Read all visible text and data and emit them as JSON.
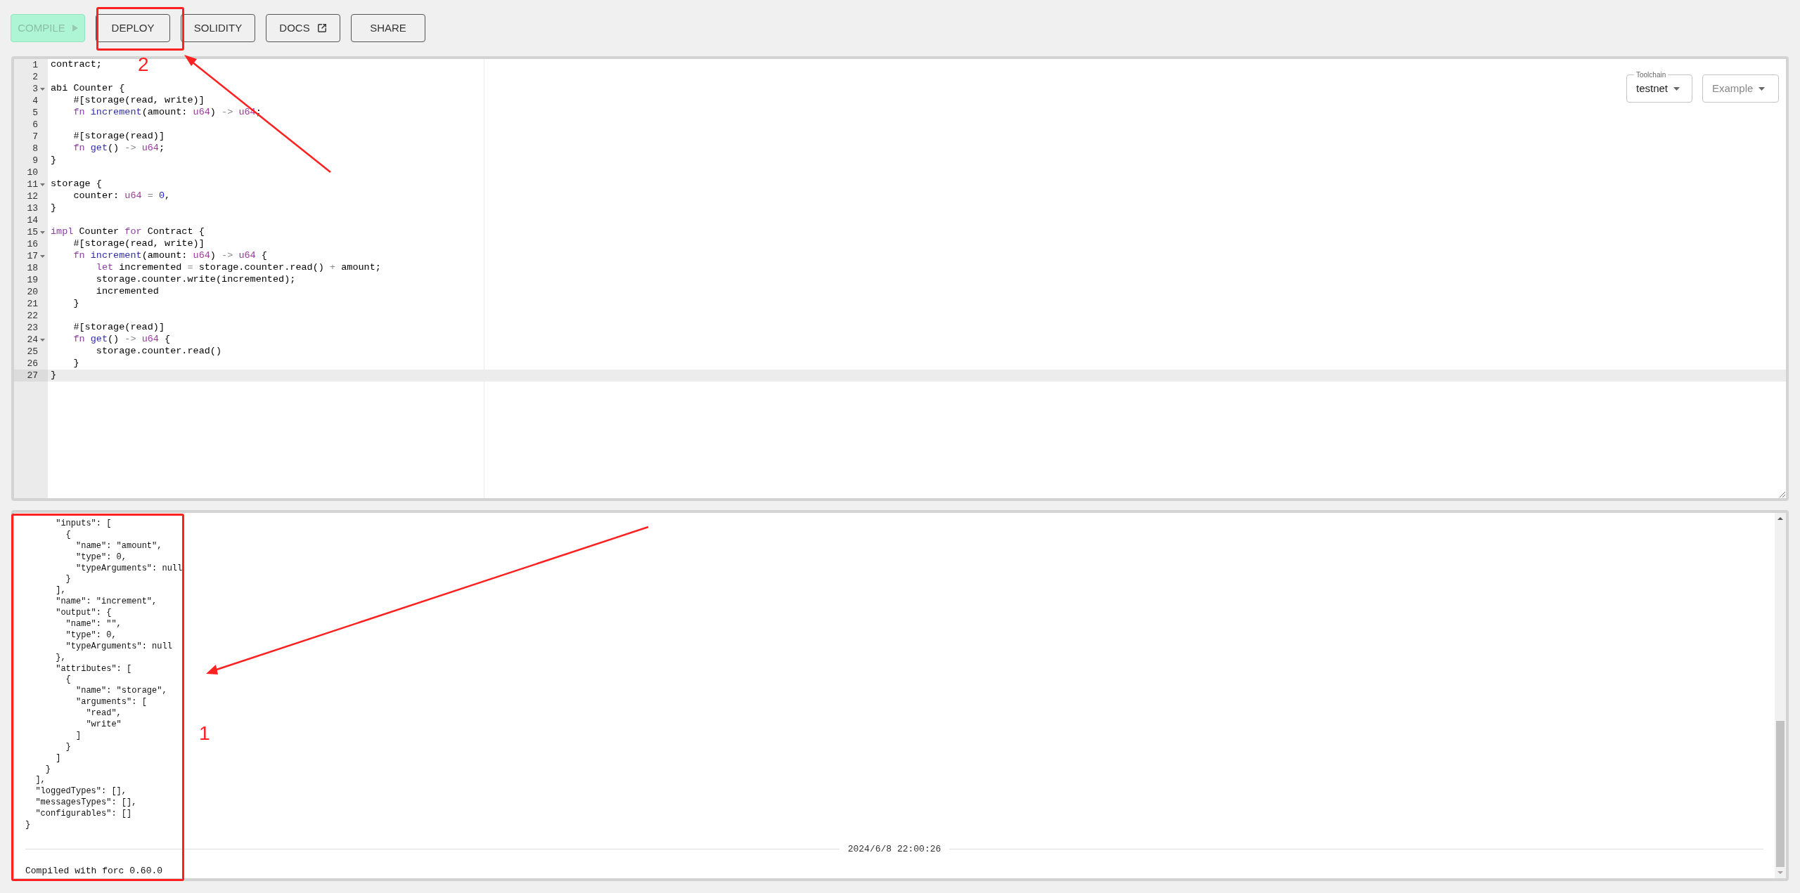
{
  "toolbar": {
    "buttons": [
      {
        "label": "COMPILE",
        "kind": "run",
        "disabled": true
      },
      {
        "label": "DEPLOY",
        "kind": "plain",
        "disabled": false
      },
      {
        "label": "SOLIDITY",
        "kind": "plain",
        "disabled": false
      },
      {
        "label": "DOCS",
        "kind": "link",
        "disabled": false
      },
      {
        "label": "SHARE",
        "kind": "plain",
        "disabled": false
      }
    ]
  },
  "editor": {
    "toolchain": {
      "legend": "Toolchain",
      "value": "testnet"
    },
    "example": {
      "placeholder": "Example"
    },
    "lines": [
      {
        "number": "1",
        "foldable": false,
        "active": false,
        "tokens": [
          {
            "t": "contract;"
          }
        ]
      },
      {
        "number": "2",
        "foldable": false,
        "active": false
      },
      {
        "number": "3",
        "foldable": true,
        "active": false,
        "tokens": [
          {
            "t": "abi Counter {"
          }
        ]
      },
      {
        "number": "4",
        "foldable": false,
        "active": false,
        "tokens": [
          {
            "t": "    #[storage(read, write)]"
          }
        ]
      },
      {
        "number": "5",
        "foldable": false,
        "active": false,
        "tokens": [
          {
            "color": "#8b3fa0",
            "t": "    fn"
          },
          {
            "color": "#2f2fa8",
            "t": " increment"
          },
          {
            "t": "(amount: "
          },
          {
            "color": "#9b3b9b",
            "t": "u64"
          },
          {
            "t": ")"
          },
          {
            "color": "#8a8a8a",
            "t": " -> "
          },
          {
            "color": "#9b3b9b",
            "t": "u64"
          },
          {
            "t": ";"
          }
        ]
      },
      {
        "number": "6",
        "foldable": false,
        "active": false
      },
      {
        "number": "7",
        "foldable": false,
        "active": false,
        "tokens": [
          {
            "t": "    #[storage(read)]"
          }
        ]
      },
      {
        "number": "8",
        "foldable": false,
        "active": false,
        "tokens": [
          {
            "color": "#8b3fa0",
            "t": "    fn"
          },
          {
            "color": "#2f2fa8",
            "t": " get"
          },
          {
            "t": "()"
          },
          {
            "color": "#8a8a8a",
            "t": " -> "
          },
          {
            "color": "#9b3b9b",
            "t": "u64"
          },
          {
            "t": ";"
          }
        ]
      },
      {
        "number": "9",
        "foldable": false,
        "active": false,
        "tokens": [
          {
            "t": "}"
          }
        ]
      },
      {
        "number": "10",
        "foldable": false,
        "active": false
      },
      {
        "number": "11",
        "foldable": true,
        "active": false,
        "tokens": [
          {
            "t": "storage {"
          }
        ]
      },
      {
        "number": "12",
        "foldable": false,
        "active": false,
        "tokens": [
          {
            "t": "    counter: "
          },
          {
            "color": "#9b3b9b",
            "t": "u64"
          },
          {
            "color": "#8a8a8a",
            "t": " = "
          },
          {
            "color": "#1b1bd1",
            "t": "0"
          },
          {
            "t": ","
          }
        ]
      },
      {
        "number": "13",
        "foldable": false,
        "active": false,
        "tokens": [
          {
            "t": "}"
          }
        ]
      },
      {
        "number": "14",
        "foldable": false,
        "active": false
      },
      {
        "number": "15",
        "foldable": true,
        "active": false,
        "tokens": [
          {
            "color": "#8b3fa0",
            "t": "impl"
          },
          {
            "t": " Counter "
          },
          {
            "color": "#8b3fa0",
            "t": "for"
          },
          {
            "t": " Contract {"
          }
        ]
      },
      {
        "number": "16",
        "foldable": false,
        "active": false,
        "tokens": [
          {
            "t": "    #[storage(read, write)]"
          }
        ]
      },
      {
        "number": "17",
        "foldable": true,
        "active": false,
        "tokens": [
          {
            "color": "#8b3fa0",
            "t": "    fn"
          },
          {
            "color": "#2f2fa8",
            "t": " increment"
          },
          {
            "t": "(amount: "
          },
          {
            "color": "#9b3b9b",
            "t": "u64"
          },
          {
            "t": ")"
          },
          {
            "color": "#8a8a8a",
            "t": " -> "
          },
          {
            "color": "#9b3b9b",
            "t": "u64"
          },
          {
            "t": " {"
          }
        ]
      },
      {
        "number": "18",
        "foldable": false,
        "active": false,
        "tokens": [
          {
            "color": "#8b3fa0",
            "t": "        let"
          },
          {
            "t": " incremented"
          },
          {
            "color": "#8a8a8a",
            "t": " = "
          },
          {
            "t": "storage.counter.read()"
          },
          {
            "color": "#8a8a8a",
            "t": " + "
          },
          {
            "t": "amount;"
          }
        ]
      },
      {
        "number": "19",
        "foldable": false,
        "active": false,
        "tokens": [
          {
            "t": "        storage.counter.write(incremented);"
          }
        ]
      },
      {
        "number": "20",
        "foldable": false,
        "active": false,
        "tokens": [
          {
            "t": "        incremented"
          }
        ]
      },
      {
        "number": "21",
        "foldable": false,
        "active": false,
        "tokens": [
          {
            "t": "    }"
          }
        ]
      },
      {
        "number": "22",
        "foldable": false,
        "active": false
      },
      {
        "number": "23",
        "foldable": false,
        "active": false,
        "tokens": [
          {
            "t": "    #[storage(read)]"
          }
        ]
      },
      {
        "number": "24",
        "foldable": true,
        "active": false,
        "tokens": [
          {
            "color": "#8b3fa0",
            "t": "    fn"
          },
          {
            "color": "#2f2fa8",
            "t": " get"
          },
          {
            "t": "()"
          },
          {
            "color": "#8a8a8a",
            "t": " -> "
          },
          {
            "color": "#9b3b9b",
            "t": "u64"
          },
          {
            "t": " {"
          }
        ]
      },
      {
        "number": "25",
        "foldable": false,
        "active": false,
        "tokens": [
          {
            "t": "        storage.counter.read()"
          }
        ]
      },
      {
        "number": "26",
        "foldable": false,
        "active": false,
        "tokens": [
          {
            "t": "    }"
          }
        ]
      },
      {
        "number": "27",
        "foldable": false,
        "active": true,
        "tokens": [
          {
            "t": "}"
          }
        ]
      }
    ]
  },
  "output": {
    "lines": [
      "      \"inputs\": [",
      "        {",
      "          \"name\": \"amount\",",
      "          \"type\": 0,",
      "          \"typeArguments\": null",
      "        }",
      "      ],",
      "      \"name\": \"increment\",",
      "      \"output\": {",
      "        \"name\": \"\",",
      "        \"type\": 0,",
      "        \"typeArguments\": null",
      "      },",
      "      \"attributes\": [",
      "        {",
      "          \"name\": \"storage\",",
      "          \"arguments\": [",
      "            \"read\",",
      "            \"write\"",
      "          ]",
      "        }",
      "      ]",
      "    }",
      "  ],",
      "  \"loggedTypes\": [],",
      "  \"messagesTypes\": [],",
      "  \"configurables\": []",
      "}"
    ],
    "timestamp": "2024/6/8 22:00:26",
    "status": "Compiled with forc 0.60.0"
  },
  "annotations": [
    {
      "label": "2"
    },
    {
      "label": "1"
    }
  ]
}
